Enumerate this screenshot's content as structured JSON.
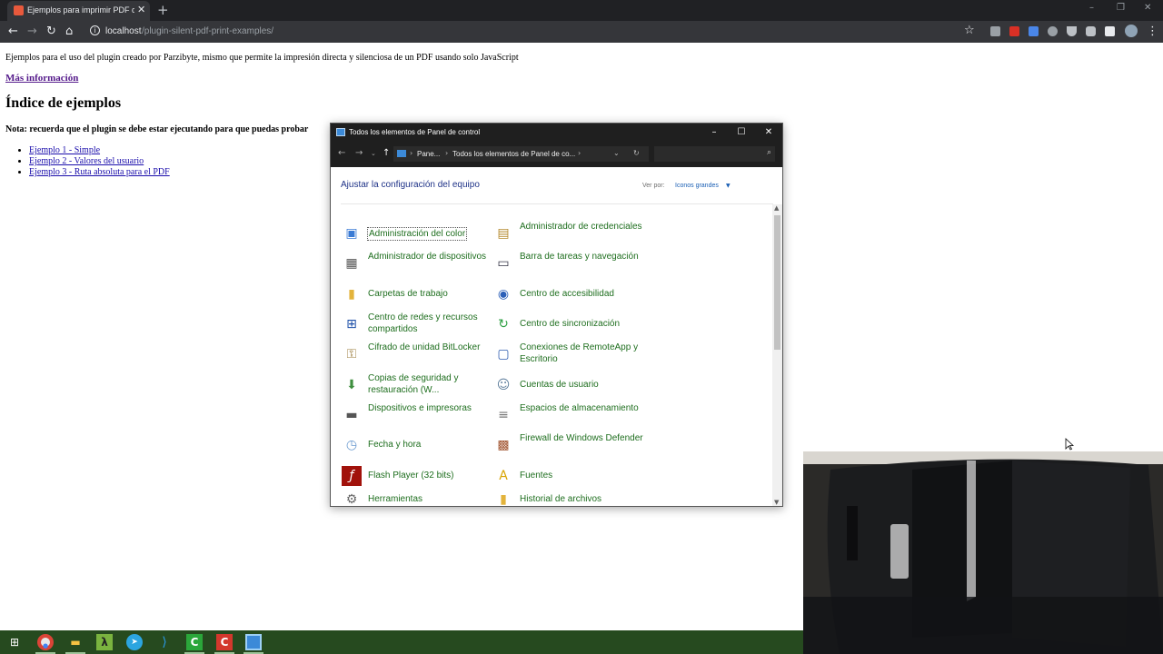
{
  "browser": {
    "tab_title": "Ejemplos para imprimir PDF dire",
    "tab_close": "✕",
    "new_tab": "+",
    "url_host": "localhost",
    "url_path": "/plugin-silent-pdf-print-examples/",
    "info_icon": "i",
    "colors": {
      "tabstrip": "#202124",
      "toolbar": "#35363a"
    }
  },
  "page": {
    "intro": "Ejemplos para el uso del plugin creado por Parzibyte, mismo que permite la impresión directa y silenciosa de un PDF usando solo JavaScript",
    "more_link": "Más información",
    "title": "Índice de ejemplos",
    "note": "Nota: recuerda que el plugin se debe estar ejecutando para que puedas probar",
    "examples": [
      "Ejemplo 1 - Simple",
      "Ejemplo 2 - Valores del usuario",
      "Ejemplo 3 - Ruta absoluta para el PDF"
    ]
  },
  "control_panel": {
    "window_title": "Todos los elementos de Panel de control",
    "breadcrumbs": [
      "Pane...",
      "Todos los elementos de Panel de co..."
    ],
    "heading": "Ajustar la configuración del equipo",
    "view_by_label": "Ver por:",
    "view_by_value": "Iconos grandes",
    "items": [
      {
        "label": "Administración del color",
        "icon": "color-management-icon"
      },
      {
        "label": "Administrador de credenciales",
        "icon": "credential-manager-icon"
      },
      {
        "label": "Administrador de dispositivos",
        "icon": "device-manager-icon"
      },
      {
        "label": "Barra de tareas y navegación",
        "icon": "taskbar-icon"
      },
      {
        "label": "Carpetas de trabajo",
        "icon": "work-folders-icon"
      },
      {
        "label": "Centro de accesibilidad",
        "icon": "ease-of-access-icon"
      },
      {
        "label": "Centro de redes y recursos compartidos",
        "icon": "network-center-icon"
      },
      {
        "label": "Centro de sincronización",
        "icon": "sync-center-icon"
      },
      {
        "label": "Cifrado de unidad BitLocker",
        "icon": "bitlocker-icon"
      },
      {
        "label": "Conexiones de RemoteApp y Escritorio",
        "icon": "remoteapp-icon"
      },
      {
        "label": "Copias de seguridad y restauración (W...",
        "icon": "backup-icon"
      },
      {
        "label": "Cuentas de usuario",
        "icon": "user-accounts-icon"
      },
      {
        "label": "Dispositivos e impresoras",
        "icon": "printer-icon"
      },
      {
        "label": "Espacios de almacenamiento",
        "icon": "storage-spaces-icon"
      },
      {
        "label": "Fecha y hora",
        "icon": "clock-icon"
      },
      {
        "label": "Firewall de Windows Defender",
        "icon": "firewall-icon"
      },
      {
        "label": "Flash Player (32 bits)",
        "icon": "flash-icon"
      },
      {
        "label": "Fuentes",
        "icon": "fonts-icon"
      },
      {
        "label": "Herramientas",
        "icon": "tools-icon"
      },
      {
        "label": "Historial de archivos",
        "icon": "file-history-icon"
      }
    ]
  },
  "taskbar": {
    "items": [
      "start-button",
      "chrome-icon",
      "file-explorer-icon",
      "lambda-app-icon",
      "telegram-icon",
      "vscode-icon",
      "camtasia-icon",
      "camtasia-recorder-icon",
      "control-panel-icon"
    ]
  }
}
